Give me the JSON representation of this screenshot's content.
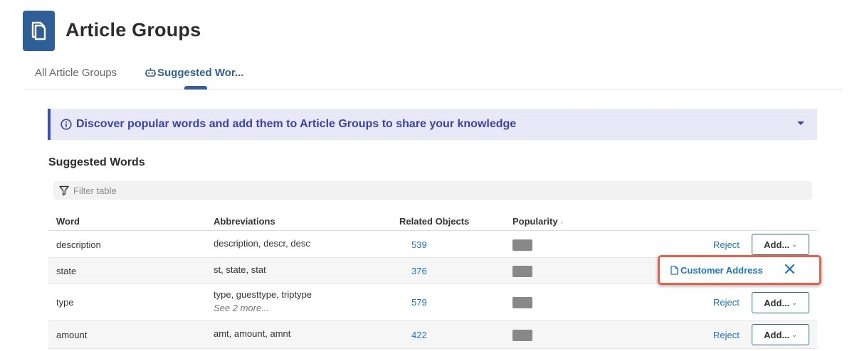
{
  "page": {
    "title": "Article Groups",
    "icon": "document-stack-icon"
  },
  "tabs": [
    {
      "label": "All Article Groups",
      "active": false
    },
    {
      "label": "Suggested Wor...",
      "active": true,
      "icon": "robot-icon"
    }
  ],
  "banner": {
    "text": "Discover popular words and add them to Article Groups to share your knowledge",
    "icon": "info-icon"
  },
  "section": {
    "title": "Suggested Words"
  },
  "filter": {
    "placeholder": "Filter table",
    "value": ""
  },
  "table": {
    "columns": [
      "Word",
      "Abbreviations",
      "Related Objects",
      "Popularity"
    ],
    "sort_indicator": "↓",
    "rows": [
      {
        "word": "description",
        "abbreviations": "description, descr, desc",
        "more": "",
        "related": "539",
        "reject": "Reject",
        "add": "Add...",
        "assigned": ""
      },
      {
        "word": "state",
        "abbreviations": "st, state, stat",
        "more": "",
        "related": "376",
        "reject": "",
        "add": "",
        "assigned": "Customer Address"
      },
      {
        "word": "type",
        "abbreviations": "type, guesttype, triptype",
        "more": "See 2 more...",
        "related": "579",
        "reject": "Reject",
        "add": "Add...",
        "assigned": ""
      },
      {
        "word": "amount",
        "abbreviations": "amt, amount, amnt",
        "more": "",
        "related": "422",
        "reject": "Reject",
        "add": "Add...",
        "assigned": ""
      }
    ]
  },
  "colors": {
    "brand": "#2f5f97",
    "banner_text": "#3644a8",
    "link": "#1f74c4",
    "highlight_border": "#e8604a"
  }
}
